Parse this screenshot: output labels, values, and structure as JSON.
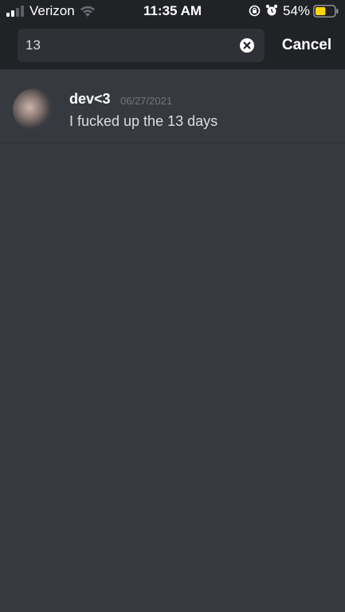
{
  "status_bar": {
    "carrier": "Verizon",
    "time": "11:35 AM",
    "battery_percent": "54%",
    "battery_level": 0.54,
    "battery_color": "#ffd60a"
  },
  "search": {
    "query": "13",
    "cancel_label": "Cancel"
  },
  "results": [
    {
      "username": "dev<3",
      "date": "06/27/2021",
      "message": "I fucked up the 13 days"
    }
  ],
  "colors": {
    "background": "#36393f",
    "header": "#202225",
    "search_box": "#2f3136",
    "muted_text": "#72767d"
  }
}
